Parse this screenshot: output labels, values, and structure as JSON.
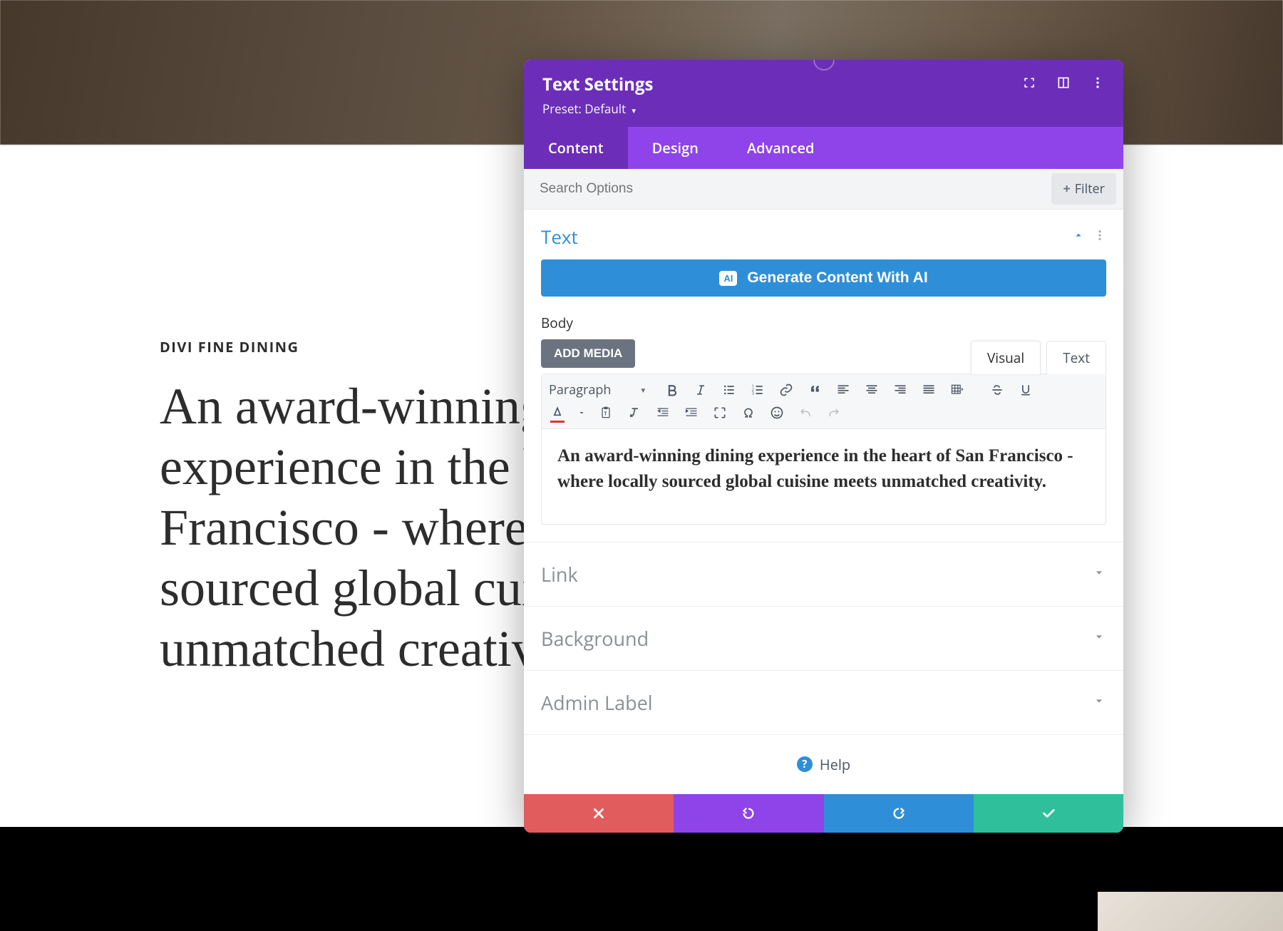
{
  "page": {
    "eyebrow": "DIVI FINE DINING",
    "headline": "An award-winning dining experience in the heart of San Francisco - where locally sourced global cuisine meets unmatched creativity."
  },
  "modal": {
    "title": "Text Settings",
    "preset_label": "Preset: Default",
    "tabs": {
      "content": "Content",
      "design": "Design",
      "advanced": "Advanced"
    },
    "search_placeholder": "Search Options",
    "filter_label": "Filter",
    "text_section": {
      "title": "Text",
      "ai_button": "Generate Content With AI",
      "ai_badge": "AI",
      "body_label": "Body",
      "add_media": "ADD MEDIA",
      "editor_tabs": {
        "visual": "Visual",
        "text": "Text"
      },
      "paragraph_label": "Paragraph",
      "content": "An award-winning dining experience in the heart of San Francisco - where locally sourced global cuisine meets unmatched creativity."
    },
    "collapsed": {
      "link": "Link",
      "background": "Background",
      "admin_label": "Admin Label"
    },
    "help": "Help"
  }
}
